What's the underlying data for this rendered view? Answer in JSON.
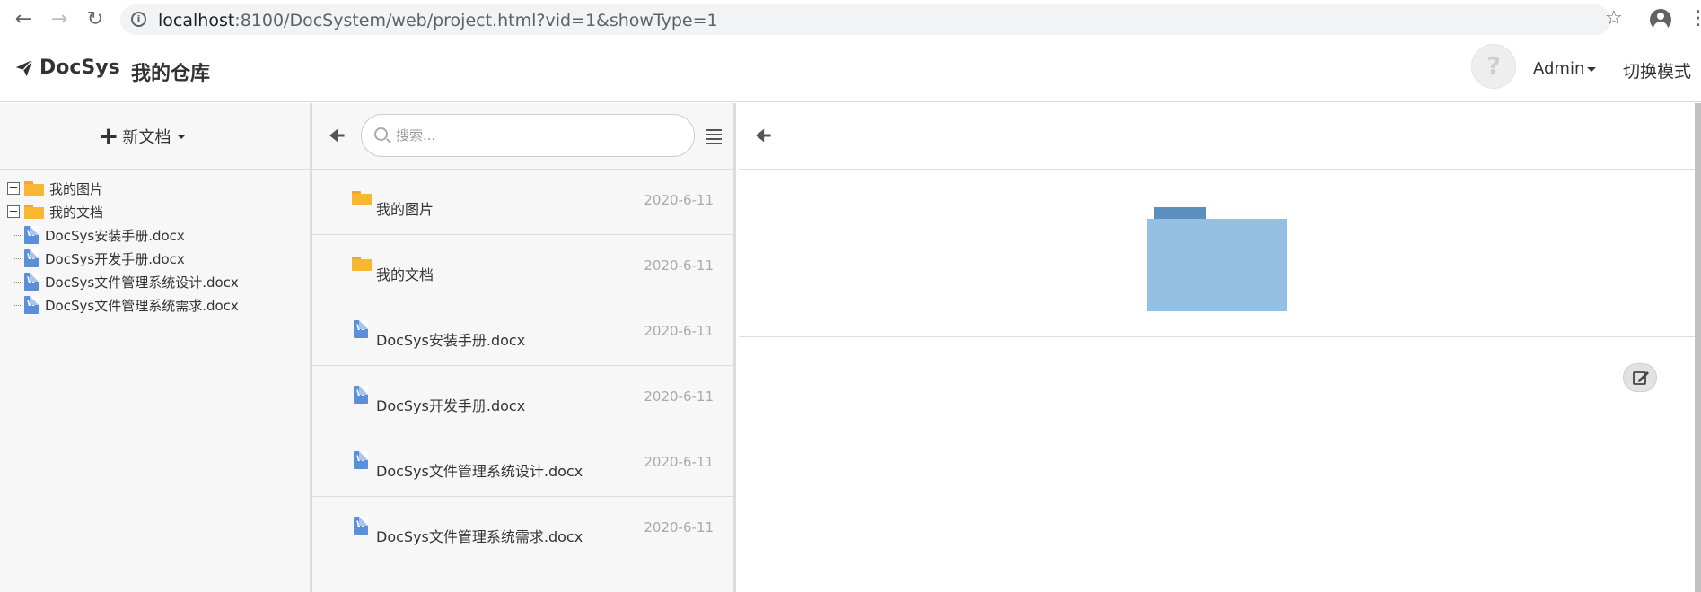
{
  "browser": {
    "url_host": "localhost",
    "url_path": ":8100/DocSystem/web/project.html?vid=1&showType=1"
  },
  "header": {
    "brand": "DocSys",
    "repo_title": "我的仓库",
    "user": "Admin",
    "mode_switch": "切换模式"
  },
  "left": {
    "new_doc_label": "新文档",
    "tree": [
      {
        "label": "我的图片",
        "type": "folder"
      },
      {
        "label": "我的文档",
        "type": "folder"
      },
      {
        "label": "DocSys安装手册.docx",
        "type": "docx"
      },
      {
        "label": "DocSys开发手册.docx",
        "type": "docx"
      },
      {
        "label": "DocSys文件管理系统设计.docx",
        "type": "docx"
      },
      {
        "label": "DocSys文件管理系统需求.docx",
        "type": "docx"
      }
    ]
  },
  "middle": {
    "search_placeholder": "搜索...",
    "files": [
      {
        "name": "我的图片",
        "type": "folder",
        "date": "2020-6-11"
      },
      {
        "name": "我的文档",
        "type": "folder",
        "date": "2020-6-11"
      },
      {
        "name": "DocSys安装手册.docx",
        "type": "docx",
        "date": "2020-6-11"
      },
      {
        "name": "DocSys开发手册.docx",
        "type": "docx",
        "date": "2020-6-11"
      },
      {
        "name": "DocSys文件管理系统设计.docx",
        "type": "docx",
        "date": "2020-6-11"
      },
      {
        "name": "DocSys文件管理系统需求.docx",
        "type": "docx",
        "date": "2020-6-11"
      }
    ]
  },
  "icons": {
    "back": "arrow-left-icon",
    "menu": "list-menu-icon",
    "edit": "edit-icon",
    "word_glyph": "W"
  },
  "colors": {
    "folder_small": "#f7b733",
    "word": "#5b8fdb",
    "big_folder": "#94c0e4",
    "big_folder_tab": "#5b8fbd"
  }
}
